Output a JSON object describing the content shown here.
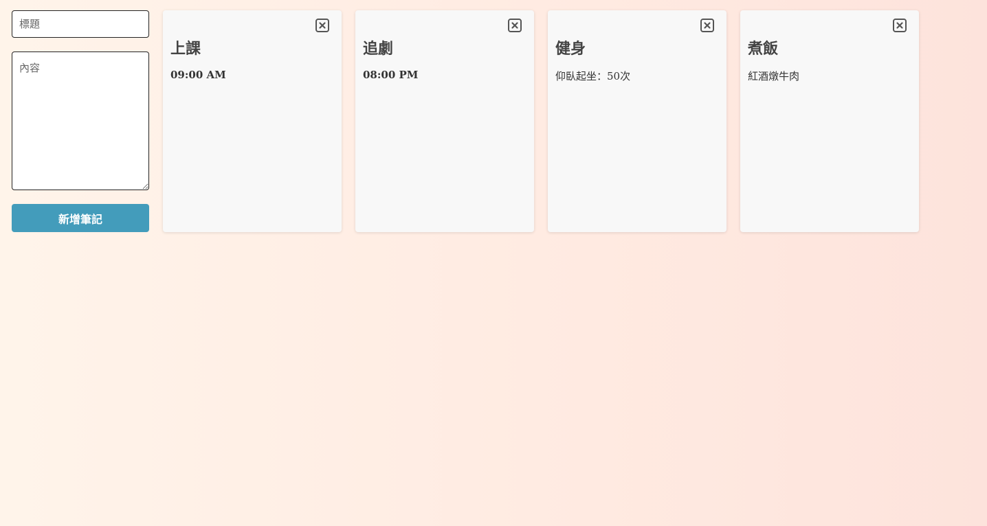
{
  "form": {
    "title_placeholder": "標題",
    "content_placeholder": "內容",
    "add_button_label": "新增筆記"
  },
  "notes": [
    {
      "title": "上課",
      "body": "09:00 AM",
      "icon": "close-icon"
    },
    {
      "title": "追劇",
      "body": "08:00 PM",
      "icon": "close-icon"
    },
    {
      "title": "健身",
      "body": "仰臥起坐：50次",
      "icon": "close-icon"
    },
    {
      "title": "煮飯",
      "body": "紅酒燉牛肉",
      "icon": "close-icon"
    }
  ],
  "colors": {
    "accent": "#439cbb",
    "card_background": "#f8f8f8",
    "background_start": "#fff4ea",
    "background_end": "#fde3dc"
  }
}
